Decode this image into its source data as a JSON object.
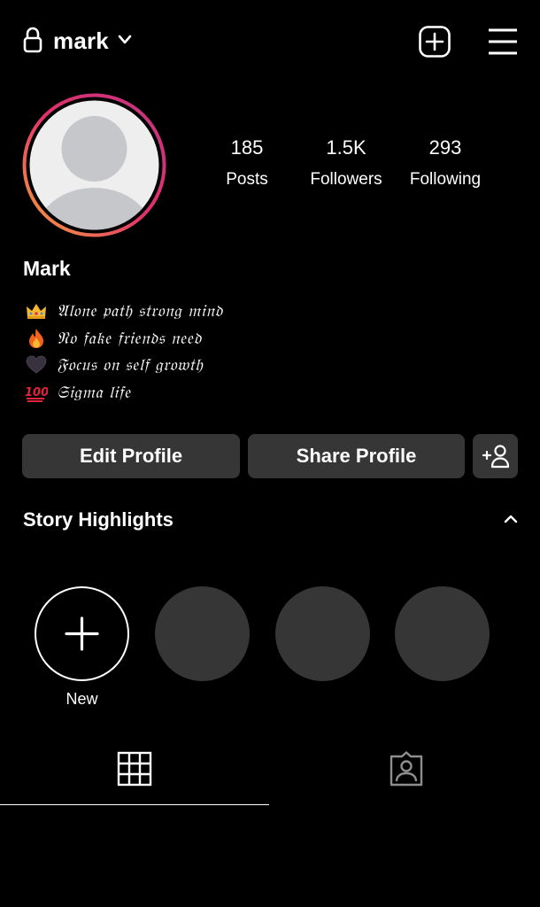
{
  "header": {
    "username": "mark",
    "icons": {
      "lock": "lock-icon",
      "dropdown": "chevron-down-icon",
      "new_post": "plus-square-icon",
      "menu": "hamburger-menu-icon"
    }
  },
  "profile": {
    "display_name": "Mark",
    "avatar": "default-avatar",
    "ring_colors": [
      "#f9a13c",
      "#e1306c",
      "#c13584"
    ],
    "stats": [
      {
        "value": "185",
        "label": "Posts"
      },
      {
        "value": "1.5K",
        "label": "Followers"
      },
      {
        "value": "293",
        "label": "Following"
      }
    ],
    "bio": [
      {
        "emoji": "crown",
        "text": "𝔄𝔩𝔬𝔫𝔢 𝔭𝔞𝔱𝔥 𝔰𝔱𝔯𝔬𝔫𝔤 𝔪𝔦𝔫𝔡"
      },
      {
        "emoji": "fire",
        "text": "𝔑𝔬 𝔣𝔞𝔨𝔢 𝔣𝔯𝔦𝔢𝔫𝔡𝔰 𝔫𝔢𝔢𝔡"
      },
      {
        "emoji": "black-heart",
        "text": "𝔉𝔬𝔠𝔲𝔰 𝔬𝔫 𝔰𝔢𝔩𝔣 𝔤𝔯𝔬𝔴𝔱𝔥"
      },
      {
        "emoji": "hundred-points",
        "text": "𝔖𝔦𝔤𝔪𝔞 𝔩𝔦𝔣𝔢"
      }
    ]
  },
  "actions": {
    "edit_label": "Edit Profile",
    "share_label": "Share Profile",
    "add_user_icon": "add-user-icon"
  },
  "highlights": {
    "title": "Story Highlights",
    "new_label": "New",
    "placeholder_color": "#363636"
  },
  "tabs": [
    {
      "icon": "grid-icon",
      "active": true
    },
    {
      "icon": "tagged-icon",
      "active": false
    }
  ]
}
